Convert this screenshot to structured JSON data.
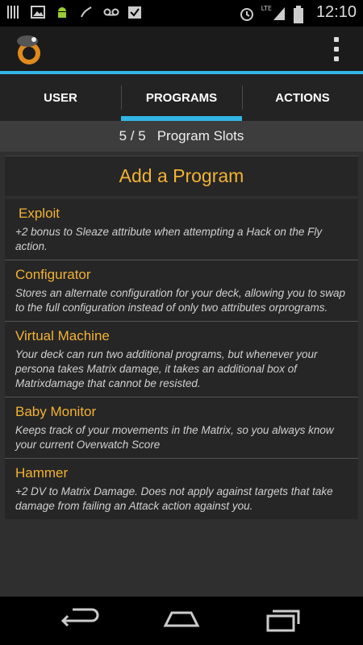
{
  "status_bar": {
    "time": "12:10",
    "network_label": "LTE",
    "icons": [
      "notification-bars-icon",
      "image-icon",
      "android-icon",
      "signal-off-icon",
      "voicemail-icon",
      "checkbox-icon",
      "alarm-icon",
      "network-signal-icon",
      "battery-icon"
    ]
  },
  "action_bar": {
    "logo_icon": "app-logo-icon",
    "overflow_icon": "overflow-menu-icon"
  },
  "tabs": [
    {
      "label": "USER"
    },
    {
      "label": "PROGRAMS",
      "active": true
    },
    {
      "label": "ACTIONS"
    }
  ],
  "slots": {
    "count": "5 / 5",
    "label": "Program Slots"
  },
  "add_program": {
    "label": "Add a Program"
  },
  "programs": [
    {
      "title": "Exploit",
      "description": "+2 bonus to Sleaze attribute when attempting a Hack on the Fly action."
    },
    {
      "title": "Configurator",
      "description": "Stores an alternate configuration for your deck, allowing you to swap to the full configuration instead of only two attributes orprograms."
    },
    {
      "title": "Virtual Machine",
      "description": "Your deck can run two additional programs, but whenever your persona takes Matrix damage, it takes an additional box of Matrixdamage that cannot be resisted."
    },
    {
      "title": "Baby Monitor",
      "description": "Keeps track of your movements in the Matrix, so you always know your current Overwatch Score"
    },
    {
      "title": "Hammer",
      "description": "+2 DV to Matrix Damage. Does not apply against targets that take damage from failing an Attack action against you."
    }
  ],
  "colors": {
    "accent_blue": "#33b5e5",
    "title_orange": "#f2b233"
  }
}
